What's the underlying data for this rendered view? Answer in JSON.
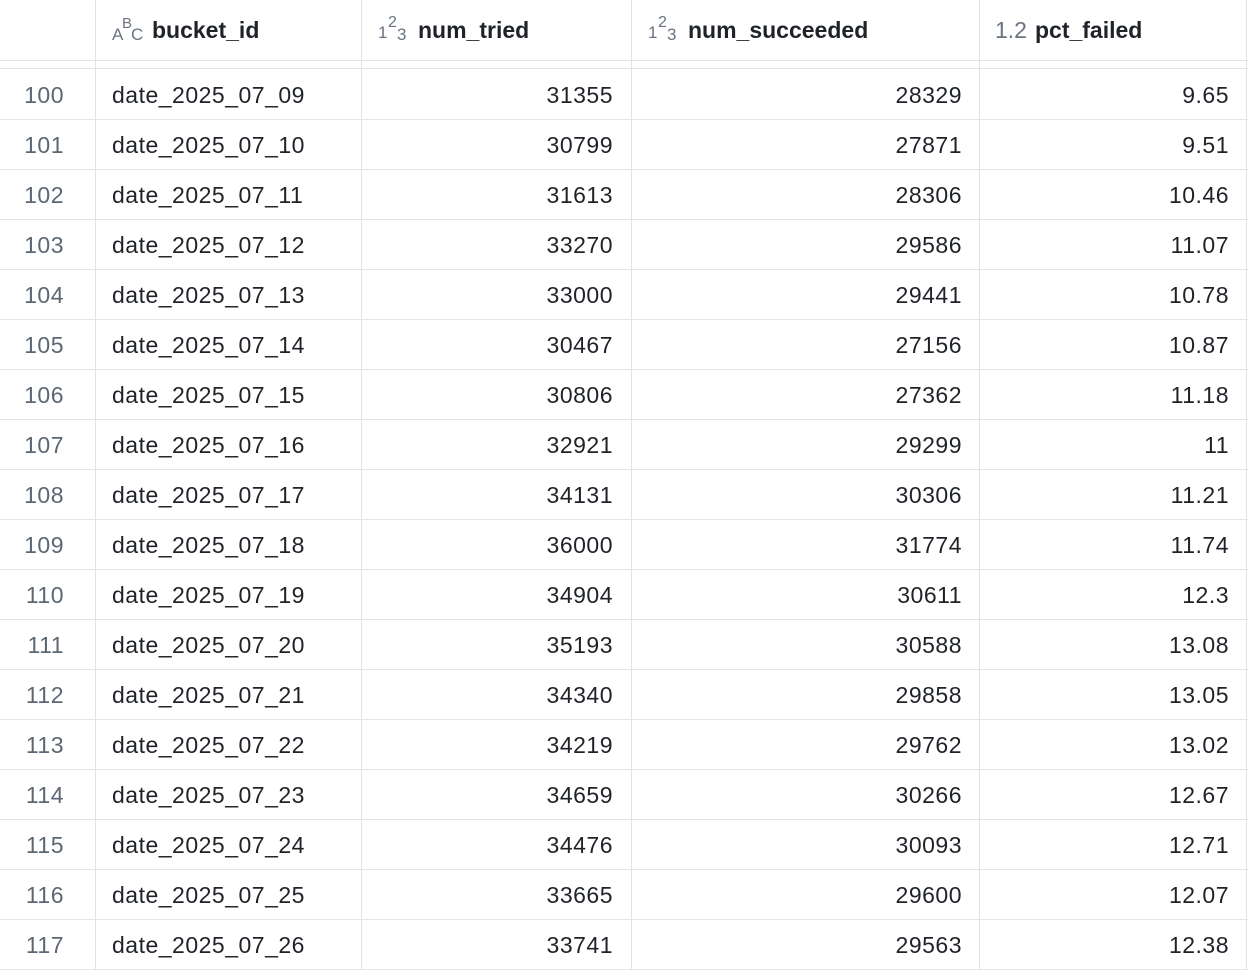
{
  "columns": [
    {
      "type_icon": "abc-type-icon",
      "name": "bucket_id"
    },
    {
      "type_icon": "int-type-icon",
      "name": "num_tried"
    },
    {
      "type_icon": "int-type-icon",
      "name": "num_succeeded"
    },
    {
      "type_icon": "decimal-type-icon",
      "type_label": "1.2",
      "name": "pct_failed"
    }
  ],
  "type_glyphs": {
    "abc": [
      "A",
      "B",
      "C"
    ],
    "int": [
      "1",
      "2",
      "3"
    ]
  },
  "rows": [
    {
      "idx": "100",
      "bucket_id": "date_2025_07_09",
      "num_tried": "31355",
      "num_succeeded": "28329",
      "pct_failed": "9.65"
    },
    {
      "idx": "101",
      "bucket_id": "date_2025_07_10",
      "num_tried": "30799",
      "num_succeeded": "27871",
      "pct_failed": "9.51"
    },
    {
      "idx": "102",
      "bucket_id": "date_2025_07_11",
      "num_tried": "31613",
      "num_succeeded": "28306",
      "pct_failed": "10.46"
    },
    {
      "idx": "103",
      "bucket_id": "date_2025_07_12",
      "num_tried": "33270",
      "num_succeeded": "29586",
      "pct_failed": "11.07"
    },
    {
      "idx": "104",
      "bucket_id": "date_2025_07_13",
      "num_tried": "33000",
      "num_succeeded": "29441",
      "pct_failed": "10.78"
    },
    {
      "idx": "105",
      "bucket_id": "date_2025_07_14",
      "num_tried": "30467",
      "num_succeeded": "27156",
      "pct_failed": "10.87"
    },
    {
      "idx": "106",
      "bucket_id": "date_2025_07_15",
      "num_tried": "30806",
      "num_succeeded": "27362",
      "pct_failed": "11.18"
    },
    {
      "idx": "107",
      "bucket_id": "date_2025_07_16",
      "num_tried": "32921",
      "num_succeeded": "29299",
      "pct_failed": "11"
    },
    {
      "idx": "108",
      "bucket_id": "date_2025_07_17",
      "num_tried": "34131",
      "num_succeeded": "30306",
      "pct_failed": "11.21"
    },
    {
      "idx": "109",
      "bucket_id": "date_2025_07_18",
      "num_tried": "36000",
      "num_succeeded": "31774",
      "pct_failed": "11.74"
    },
    {
      "idx": "110",
      "bucket_id": "date_2025_07_19",
      "num_tried": "34904",
      "num_succeeded": "30611",
      "pct_failed": "12.3"
    },
    {
      "idx": "111",
      "bucket_id": "date_2025_07_20",
      "num_tried": "35193",
      "num_succeeded": "30588",
      "pct_failed": "13.08"
    },
    {
      "idx": "112",
      "bucket_id": "date_2025_07_21",
      "num_tried": "34340",
      "num_succeeded": "29858",
      "pct_failed": "13.05"
    },
    {
      "idx": "113",
      "bucket_id": "date_2025_07_22",
      "num_tried": "34219",
      "num_succeeded": "29762",
      "pct_failed": "13.02"
    },
    {
      "idx": "114",
      "bucket_id": "date_2025_07_23",
      "num_tried": "34659",
      "num_succeeded": "30266",
      "pct_failed": "12.67"
    },
    {
      "idx": "115",
      "bucket_id": "date_2025_07_24",
      "num_tried": "34476",
      "num_succeeded": "30093",
      "pct_failed": "12.71"
    },
    {
      "idx": "116",
      "bucket_id": "date_2025_07_25",
      "num_tried": "33665",
      "num_succeeded": "29600",
      "pct_failed": "12.07"
    },
    {
      "idx": "117",
      "bucket_id": "date_2025_07_26",
      "num_tried": "33741",
      "num_succeeded": "29563",
      "pct_failed": "12.38"
    }
  ]
}
